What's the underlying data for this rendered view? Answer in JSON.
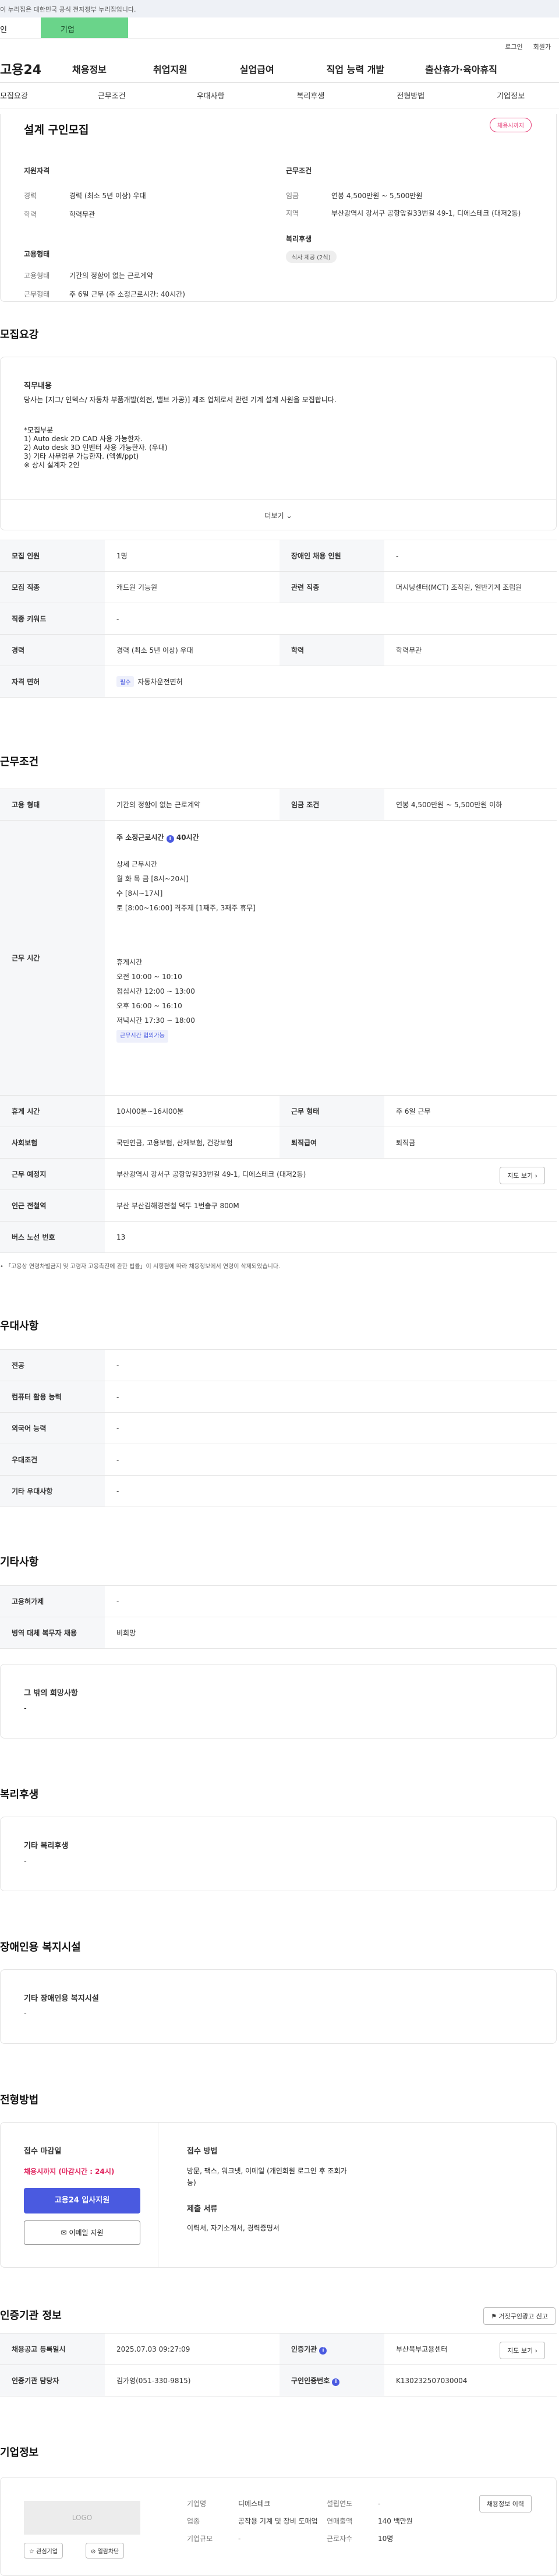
{
  "gov_bar": "이 누리집은 대한민국 공식 전자정부 누리집입니다.",
  "top_tabs": [
    "인",
    "기업"
  ],
  "login_links": [
    "로그인",
    "회원가"
  ],
  "logo": "고용24",
  "gnb": [
    "채용정보",
    "취업지원",
    "실업급여",
    "직업 능력 개발",
    "출산휴가·육아휴직"
  ],
  "subtabs": [
    "모집요강",
    "근무조건",
    "우대사항",
    "복리후생",
    "전형방법",
    "기업정보"
  ],
  "summary": {
    "title": "설계 구인모집",
    "badge": "채용시까지",
    "qual_title": "지원자격",
    "career_k": "경력",
    "career_v": "경력 (최소 5년 이상) 우대",
    "edu_k": "학력",
    "edu_v": "학력무관",
    "emp_title": "고용형태",
    "emptype_k": "고용형태",
    "emptype_v": "기간의 정함이 없는 근로계약",
    "worktype_k": "근무형태",
    "worktype_v": "주 6일 근무 (주 소정근로시간: 40시간)",
    "cond_title": "근무조건",
    "wage_k": "임금",
    "wage_v": "연봉 4,500만원 ~ 5,500만원",
    "region_k": "지역",
    "region_v": "부산광역시 강서구 공항앞길33번길 49-1, 디에스테크 (대저2동)",
    "welfare_title": "복리후생",
    "welfare_tag": "식사 제공 (2식)"
  },
  "recruit": {
    "title": "모집요강",
    "job_title": "직무내용",
    "job_text": "당사는 [지그/ 인덱스/ 자동차 부품개발(회전, 밸브 가공)] 제조 업체로서 관련 기계 설계 사원을 모집합니다.",
    "job_lines": [
      "*모집부분",
      "1) Auto desk 2D CAD 사용 가능한자.",
      "2) Auto desk 3D 인벤터 사용 가능한자. (우대)",
      "3) 기타 사무업무 가능한자. (엑셀/ppt)",
      "※ 상시 설계자 2인"
    ],
    "more": "더보기"
  },
  "recruit_table": {
    "r1": [
      "모집 인원",
      "1명",
      "장애인 채용 인원",
      "-"
    ],
    "r2": [
      "모집 직종",
      "캐드원 기능원",
      "관련 직종",
      "머시닝센터(MCT) 조작원, 일반기계 조립원"
    ],
    "r3": [
      "직종 키워드",
      "-"
    ],
    "r4": [
      "경력",
      "경력 (최소 5년 이상) 우대",
      "학력",
      "학력무관"
    ],
    "r5": [
      "자격 면허",
      "필수",
      "자동차운전면허"
    ]
  },
  "work": {
    "title": "근무조건",
    "emp_k": "고용 형태",
    "emp_v": "기간의 정함이 없는 근로계약",
    "wage_k": "임금 조건",
    "wage_v": "연봉 4,500만원 ~ 5,500만원 이하",
    "time_k": "근무 시간",
    "time_head": "주 소정근로시간",
    "time_hours": "40시간",
    "time_lines": [
      "상세 근무시간",
      "월 화 목 금 [8시~20시]",
      "수 [8시~17시]",
      "토 [8:00~16:00] 격주제 [1째주, 3째주 휴무]",
      "",
      "휴게시간",
      "오전 10:00 ~ 10:10",
      "점심시간 12:00 ~ 13:00",
      "오후 16:00 ~ 16:10",
      "저녁시간 17:30 ~ 18:00"
    ],
    "time_tag": "근무시간 협의가능",
    "rest_k": "휴게 시간",
    "rest_v": "10시00분~16시00분",
    "shift_k": "근무 형태",
    "shift_v": "주 6일 근무",
    "ins_k": "사회보험",
    "ins_v": "국민연금, 고용보험, 산재보험, 건강보험",
    "ret_k": "퇴직급여",
    "ret_v": "퇴직금",
    "addr_k": "근무 예정지",
    "addr_v": "부산광역시 강서구 공항앞길33번길 49-1, 디에스테크 (대저2동)",
    "map_btn": "지도 보기",
    "subway_k": "인근 전철역",
    "subway_v": "부산 부산김해경전철 덕두 1번출구 800M",
    "bus_k": "버스 노선 번호",
    "bus_v": "13",
    "note": "「고용상 연령차별금지 및 고령자 고용촉진에 관한 법률」이 시행됨에 따라 채용정보에서 연령이 삭제되었습니다."
  },
  "pref": {
    "title": "우대사항",
    "rows": [
      [
        "전공",
        "-"
      ],
      [
        "컴퓨터 활용 능력",
        "-"
      ],
      [
        "외국어 능력",
        "-"
      ],
      [
        "우대조건",
        "-"
      ],
      [
        "기타 우대사항",
        "-"
      ]
    ]
  },
  "etc": {
    "title": "기타사항",
    "rows": [
      [
        "고용허가제",
        "-"
      ],
      [
        "병역 대체 복무자 채용",
        "비희망"
      ]
    ],
    "box_title": "그 밖의 희망사항",
    "box_v": "-"
  },
  "welfare": {
    "title": "복리후생",
    "box_title": "기타 복리후생",
    "box_v": "-"
  },
  "disabled": {
    "title": "장애인용 복지시설",
    "box_title": "기타 장애인용 복지시설",
    "box_v": "-"
  },
  "apply": {
    "title": "전형방법",
    "deadline_h": "접수 마감일",
    "deadline_v": "채용시까지 (마감시간 : 24시)",
    "apply_btn": "고용24 입사지원",
    "email_btn": "이메일 지원",
    "method_h": "접수 방법",
    "method_v": "방문, 팩스, 워크넷, 이메일 (개인회원 로그인 후 조회가능)",
    "docs_h": "제출 서류",
    "docs_v": "이력서, 자기소개서, 경력증명서"
  },
  "cert": {
    "title": "인증기관 정보",
    "btn": "거짓구인광고 신고",
    "r1": [
      "채용공고 등록일시",
      "2025.07.03 09:27:09",
      "인증기관",
      "부산북부고용센터",
      "지도 보기"
    ],
    "r2": [
      "인증기관 담당자",
      "김가영(051-330-9815)",
      "구인인증번호",
      "K130232507030004"
    ]
  },
  "company": {
    "title": "기업정보",
    "logo": "LOGO",
    "fav": "관심기업",
    "block": "열람차단",
    "name_k": "기업명",
    "name_v": "디에스테크",
    "ind_k": "업종",
    "ind_v": "공작용 기계 및 장비 도매업",
    "size_k": "기업규모",
    "size_v": "-",
    "year_k": "설립연도",
    "year_v": "-",
    "sales_k": "연매출액",
    "sales_v": "140 백만원",
    "emp_k": "근로자수",
    "emp_v": "10명",
    "history_btn": "채용정보 이력"
  }
}
